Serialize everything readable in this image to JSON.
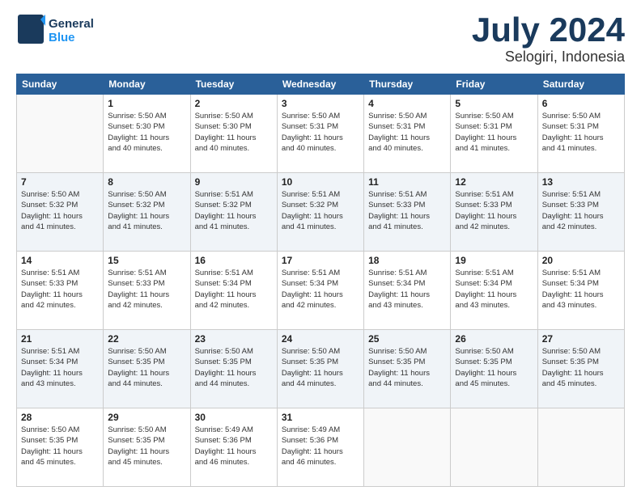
{
  "header": {
    "logo_line1": "General",
    "logo_line2": "Blue",
    "month": "July 2024",
    "location": "Selogiri, Indonesia"
  },
  "weekdays": [
    "Sunday",
    "Monday",
    "Tuesday",
    "Wednesday",
    "Thursday",
    "Friday",
    "Saturday"
  ],
  "weeks": [
    [
      {
        "day": "",
        "content": ""
      },
      {
        "day": "1",
        "content": "Sunrise: 5:50 AM\nSunset: 5:30 PM\nDaylight: 11 hours\nand 40 minutes."
      },
      {
        "day": "2",
        "content": "Sunrise: 5:50 AM\nSunset: 5:30 PM\nDaylight: 11 hours\nand 40 minutes."
      },
      {
        "day": "3",
        "content": "Sunrise: 5:50 AM\nSunset: 5:31 PM\nDaylight: 11 hours\nand 40 minutes."
      },
      {
        "day": "4",
        "content": "Sunrise: 5:50 AM\nSunset: 5:31 PM\nDaylight: 11 hours\nand 40 minutes."
      },
      {
        "day": "5",
        "content": "Sunrise: 5:50 AM\nSunset: 5:31 PM\nDaylight: 11 hours\nand 41 minutes."
      },
      {
        "day": "6",
        "content": "Sunrise: 5:50 AM\nSunset: 5:31 PM\nDaylight: 11 hours\nand 41 minutes."
      }
    ],
    [
      {
        "day": "7",
        "content": "Sunrise: 5:50 AM\nSunset: 5:32 PM\nDaylight: 11 hours\nand 41 minutes."
      },
      {
        "day": "8",
        "content": "Sunrise: 5:50 AM\nSunset: 5:32 PM\nDaylight: 11 hours\nand 41 minutes."
      },
      {
        "day": "9",
        "content": "Sunrise: 5:51 AM\nSunset: 5:32 PM\nDaylight: 11 hours\nand 41 minutes."
      },
      {
        "day": "10",
        "content": "Sunrise: 5:51 AM\nSunset: 5:32 PM\nDaylight: 11 hours\nand 41 minutes."
      },
      {
        "day": "11",
        "content": "Sunrise: 5:51 AM\nSunset: 5:33 PM\nDaylight: 11 hours\nand 41 minutes."
      },
      {
        "day": "12",
        "content": "Sunrise: 5:51 AM\nSunset: 5:33 PM\nDaylight: 11 hours\nand 42 minutes."
      },
      {
        "day": "13",
        "content": "Sunrise: 5:51 AM\nSunset: 5:33 PM\nDaylight: 11 hours\nand 42 minutes."
      }
    ],
    [
      {
        "day": "14",
        "content": "Sunrise: 5:51 AM\nSunset: 5:33 PM\nDaylight: 11 hours\nand 42 minutes."
      },
      {
        "day": "15",
        "content": "Sunrise: 5:51 AM\nSunset: 5:33 PM\nDaylight: 11 hours\nand 42 minutes."
      },
      {
        "day": "16",
        "content": "Sunrise: 5:51 AM\nSunset: 5:34 PM\nDaylight: 11 hours\nand 42 minutes."
      },
      {
        "day": "17",
        "content": "Sunrise: 5:51 AM\nSunset: 5:34 PM\nDaylight: 11 hours\nand 42 minutes."
      },
      {
        "day": "18",
        "content": "Sunrise: 5:51 AM\nSunset: 5:34 PM\nDaylight: 11 hours\nand 43 minutes."
      },
      {
        "day": "19",
        "content": "Sunrise: 5:51 AM\nSunset: 5:34 PM\nDaylight: 11 hours\nand 43 minutes."
      },
      {
        "day": "20",
        "content": "Sunrise: 5:51 AM\nSunset: 5:34 PM\nDaylight: 11 hours\nand 43 minutes."
      }
    ],
    [
      {
        "day": "21",
        "content": "Sunrise: 5:51 AM\nSunset: 5:34 PM\nDaylight: 11 hours\nand 43 minutes."
      },
      {
        "day": "22",
        "content": "Sunrise: 5:50 AM\nSunset: 5:35 PM\nDaylight: 11 hours\nand 44 minutes."
      },
      {
        "day": "23",
        "content": "Sunrise: 5:50 AM\nSunset: 5:35 PM\nDaylight: 11 hours\nand 44 minutes."
      },
      {
        "day": "24",
        "content": "Sunrise: 5:50 AM\nSunset: 5:35 PM\nDaylight: 11 hours\nand 44 minutes."
      },
      {
        "day": "25",
        "content": "Sunrise: 5:50 AM\nSunset: 5:35 PM\nDaylight: 11 hours\nand 44 minutes."
      },
      {
        "day": "26",
        "content": "Sunrise: 5:50 AM\nSunset: 5:35 PM\nDaylight: 11 hours\nand 45 minutes."
      },
      {
        "day": "27",
        "content": "Sunrise: 5:50 AM\nSunset: 5:35 PM\nDaylight: 11 hours\nand 45 minutes."
      }
    ],
    [
      {
        "day": "28",
        "content": "Sunrise: 5:50 AM\nSunset: 5:35 PM\nDaylight: 11 hours\nand 45 minutes."
      },
      {
        "day": "29",
        "content": "Sunrise: 5:50 AM\nSunset: 5:35 PM\nDaylight: 11 hours\nand 45 minutes."
      },
      {
        "day": "30",
        "content": "Sunrise: 5:49 AM\nSunset: 5:36 PM\nDaylight: 11 hours\nand 46 minutes."
      },
      {
        "day": "31",
        "content": "Sunrise: 5:49 AM\nSunset: 5:36 PM\nDaylight: 11 hours\nand 46 minutes."
      },
      {
        "day": "",
        "content": ""
      },
      {
        "day": "",
        "content": ""
      },
      {
        "day": "",
        "content": ""
      }
    ]
  ]
}
